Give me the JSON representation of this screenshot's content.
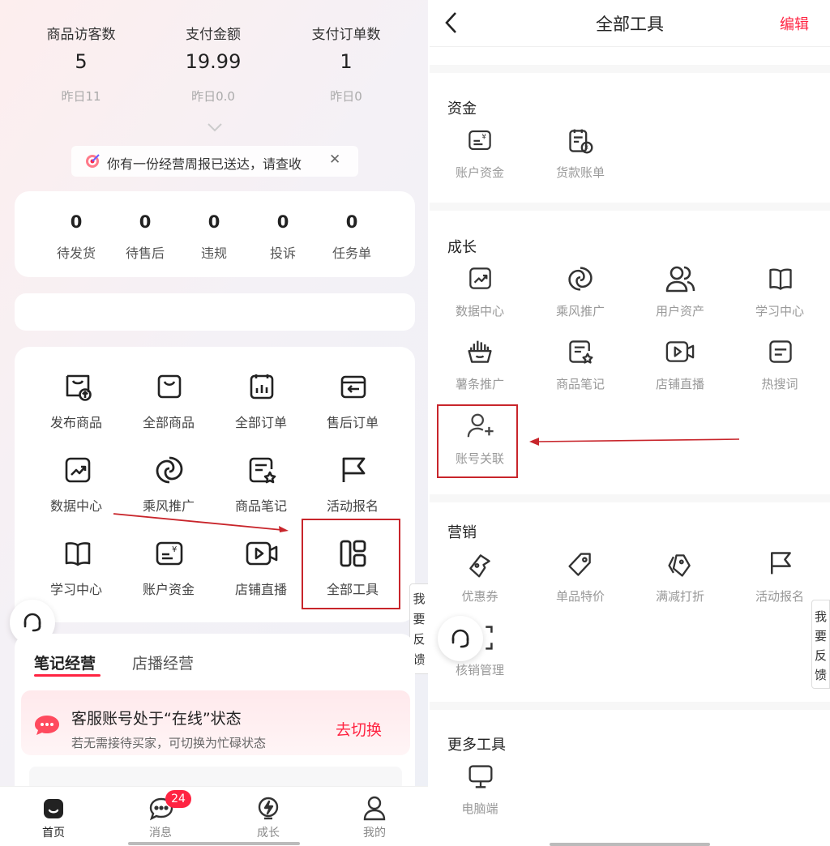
{
  "left": {
    "stats": [
      {
        "label": "商品访客数",
        "value": "5",
        "sub": "昨日11"
      },
      {
        "label": "支付金额",
        "value": "19.99",
        "sub": "昨日0.0"
      },
      {
        "label": "支付订单数",
        "value": "1",
        "sub": "昨日0"
      }
    ],
    "notice": {
      "text": "你有一份经营周报已送达，请查收",
      "close": "✕"
    },
    "order_counts": [
      {
        "value": "0",
        "label": "待发货"
      },
      {
        "value": "0",
        "label": "待售后"
      },
      {
        "value": "0",
        "label": "违规"
      },
      {
        "value": "0",
        "label": "投诉"
      },
      {
        "value": "0",
        "label": "任务单"
      }
    ],
    "tools": [
      {
        "label": "发布商品",
        "icon": "bag-upload-icon"
      },
      {
        "label": "全部商品",
        "icon": "bag-icon"
      },
      {
        "label": "全部订单",
        "icon": "order-icon"
      },
      {
        "label": "售后订单",
        "icon": "return-icon"
      },
      {
        "label": "数据中心",
        "icon": "chart-icon"
      },
      {
        "label": "乘风推广",
        "icon": "swirl-icon"
      },
      {
        "label": "商品笔记",
        "icon": "note-icon"
      },
      {
        "label": "活动报名",
        "icon": "flag-icon"
      },
      {
        "label": "学习中心",
        "icon": "book-icon"
      },
      {
        "label": "账户资金",
        "icon": "wallet-icon"
      },
      {
        "label": "店铺直播",
        "icon": "video-icon"
      },
      {
        "label": "全部工具",
        "icon": "grid-icon"
      }
    ],
    "feedback": "我要反馈",
    "tabs": [
      {
        "label": "笔记经营"
      },
      {
        "label": "店播经营"
      }
    ],
    "service": {
      "title": "客服账号处于“在线”状态",
      "subtitle": "若无需接待买家，可切换为忙碌状态",
      "action": "去切换"
    },
    "bottom_nav": [
      {
        "label": "首页",
        "icon": "home-icon"
      },
      {
        "label": "消息",
        "icon": "message-icon",
        "badge": "24"
      },
      {
        "label": "成长",
        "icon": "growth-icon"
      },
      {
        "label": "我的",
        "icon": "user-icon"
      }
    ]
  },
  "right": {
    "title": "全部工具",
    "edit": "编辑",
    "sections": {
      "funds": {
        "title": "资金",
        "items": [
          {
            "label": "账户资金",
            "icon": "wallet-icon"
          },
          {
            "label": "货款账单",
            "icon": "bill-icon"
          }
        ]
      },
      "growth": {
        "title": "成长",
        "items": [
          {
            "label": "数据中心",
            "icon": "chart-icon"
          },
          {
            "label": "乘风推广",
            "icon": "swirl-icon"
          },
          {
            "label": "用户资产",
            "icon": "users-icon"
          },
          {
            "label": "学习中心",
            "icon": "book-icon"
          },
          {
            "label": "薯条推广",
            "icon": "fries-icon"
          },
          {
            "label": "商品笔记",
            "icon": "note-icon"
          },
          {
            "label": "店铺直播",
            "icon": "video-icon"
          },
          {
            "label": "热搜词",
            "icon": "hot-search-icon"
          },
          {
            "label": "账号关联",
            "icon": "user-add-icon"
          }
        ]
      },
      "marketing": {
        "title": "营销",
        "items": [
          {
            "label": "优惠券",
            "icon": "coupon-icon"
          },
          {
            "label": "单品特价",
            "icon": "tag-icon"
          },
          {
            "label": "满减打折",
            "icon": "tags-icon"
          },
          {
            "label": "活动报名",
            "icon": "flag-icon"
          },
          {
            "label": "核销管理",
            "icon": "scan-icon"
          }
        ]
      },
      "more": {
        "title": "更多工具",
        "items": [
          {
            "label": "电脑端",
            "icon": "desktop-icon"
          }
        ]
      }
    },
    "feedback": "我要反馈"
  },
  "colors": {
    "accent": "#ff2442",
    "annotation": "#c8252b",
    "muted": "#999999"
  }
}
